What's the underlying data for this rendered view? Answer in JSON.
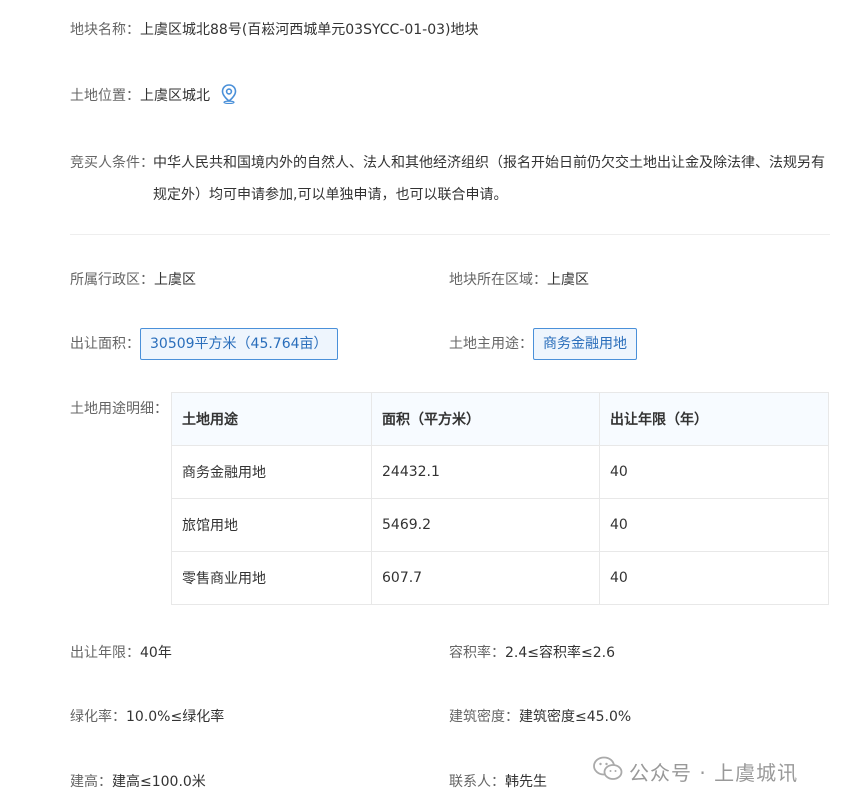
{
  "plot": {
    "name_label": "地块名称：",
    "name_value": "上虞区城北88号(百崧河西城单元03SYCC-01-03)地块",
    "location_label": "土地位置：",
    "location_value": "上虞区城北",
    "location_icon": "map-pin-icon",
    "condition_label": "竞买人条件：",
    "condition_value": "中华人民共和国境内外的自然人、法人和其他经济组织（报名开始日前仍欠交土地出让金及除法律、法规另有规定外）均可申请参加,可以单独申请，也可以联合申请。"
  },
  "details": {
    "admin_label": "所属行政区：",
    "admin_value": "上虞区",
    "region_label": "地块所在区域：",
    "region_value": "上虞区",
    "area_label": "出让面积：",
    "area_value": "30509平方米（45.764亩）",
    "use_label": "土地主用途：",
    "use_value": "商务金融用地",
    "table_label": "土地用途明细：",
    "term_label": "出让年限：",
    "term_value": "40年",
    "far_label": "容积率：",
    "far_value": "2.4≤容积率≤2.6",
    "green_label": "绿化率：",
    "green_value": "10.0%≤绿化率",
    "density_label": "建筑密度：",
    "density_value": "建筑密度≤45.0%",
    "height_label": "建高：",
    "height_value": "建高≤100.0米",
    "contact_label": "联系人：",
    "contact_value": "韩先生"
  },
  "table": {
    "headers": [
      "土地用途",
      "面积（平方米）",
      "出让年限（年）"
    ],
    "rows": [
      [
        "商务金融用地",
        "24432.1",
        "40"
      ],
      [
        "旅馆用地",
        "5469.2",
        "40"
      ],
      [
        "零售商业用地",
        "607.7",
        "40"
      ]
    ]
  },
  "watermark": {
    "text": "公众号 · 上虞城讯",
    "icon": "wechat-icon"
  },
  "colors": {
    "accent": "#4a90d9",
    "tag_bg": "#eef5fd"
  }
}
